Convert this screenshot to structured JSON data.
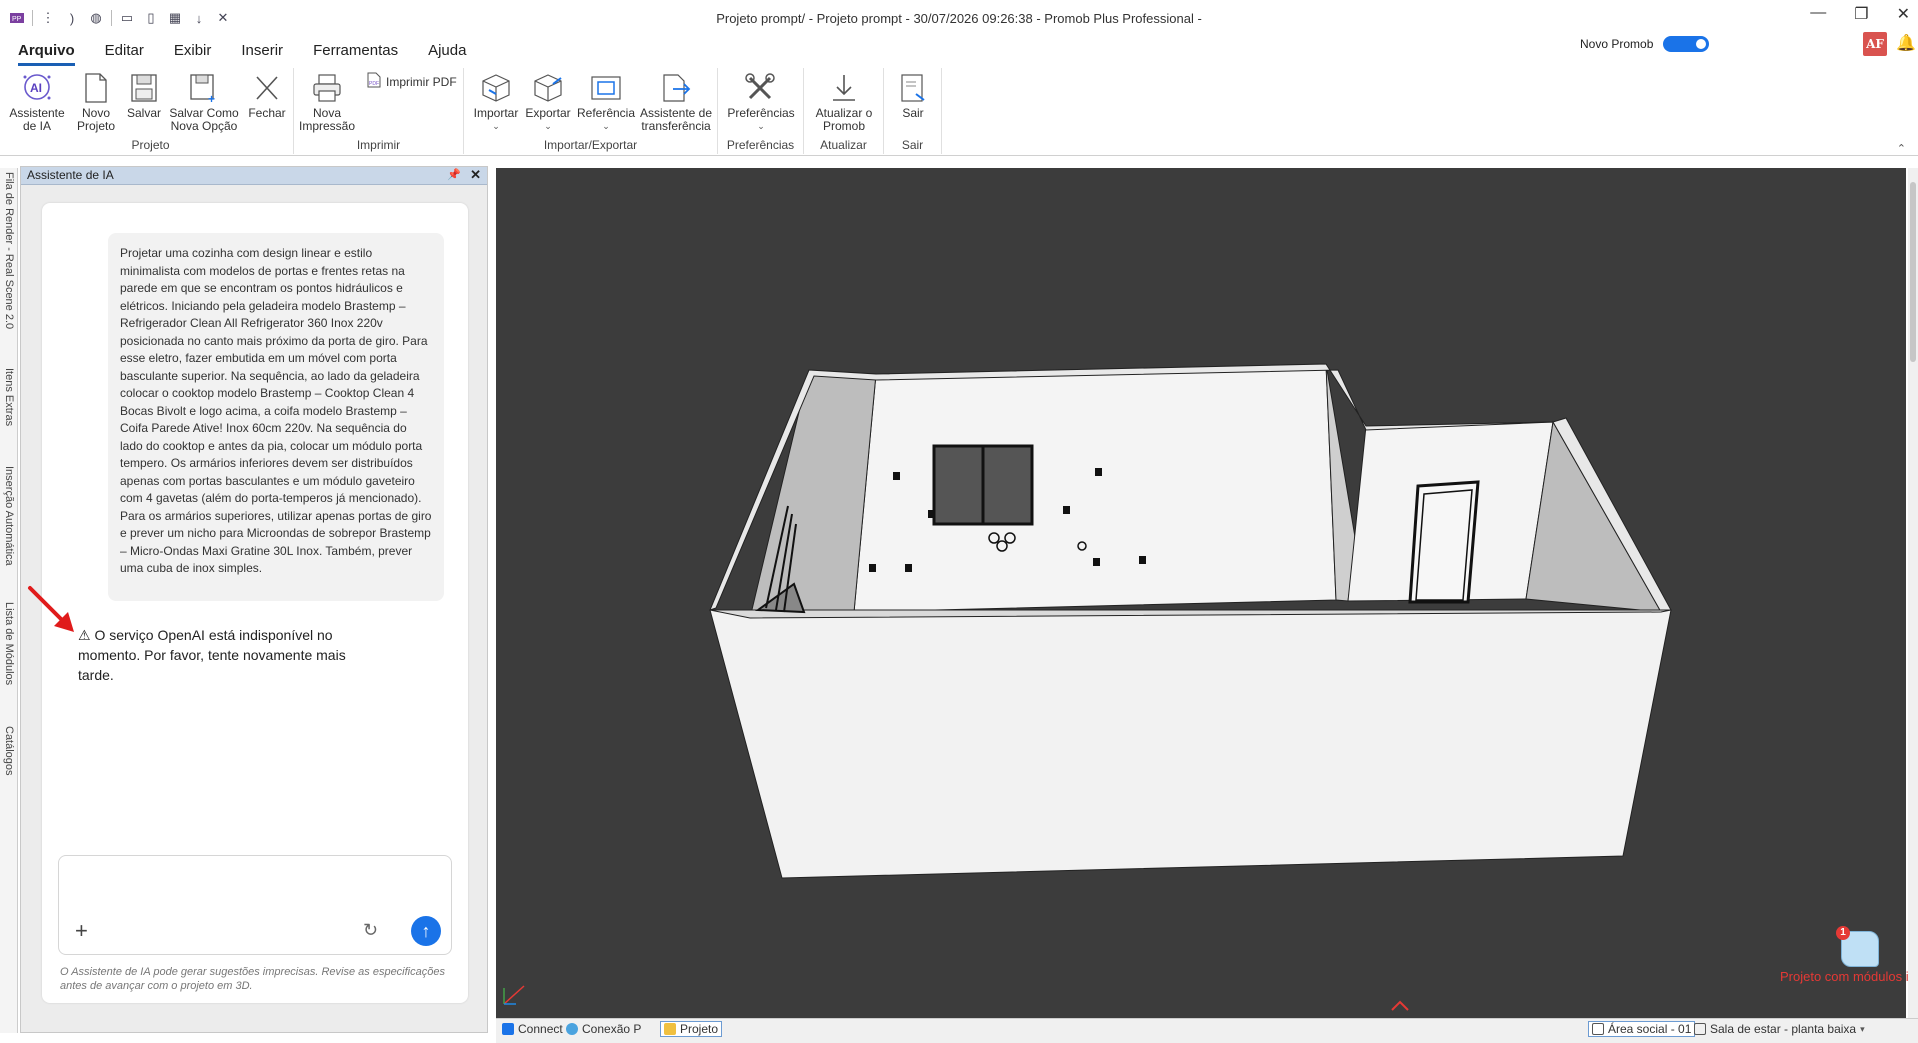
{
  "window": {
    "title": "Projeto prompt/ - Projeto prompt - 30/07/2026 09:26:38 - Promob Plus Professional -"
  },
  "menu": [
    "Arquivo",
    "Editar",
    "Exibir",
    "Inserir",
    "Ferramentas",
    "Ajuda"
  ],
  "header": {
    "novo_promob_label": "Novo Promob",
    "novo_promob_enabled": true,
    "user_initials": "AF"
  },
  "ribbon": {
    "projeto": {
      "label": "Projeto",
      "buttons": [
        "Assistente de IA",
        "Novo Projeto",
        "Salvar",
        "Salvar Como Nova Opção",
        "Fechar"
      ]
    },
    "imprimir": {
      "label": "Imprimir",
      "buttons": [
        "Nova Impressão",
        "Imprimir PDF"
      ]
    },
    "importar_exportar": {
      "label": "Importar/Exportar",
      "buttons": [
        "Importar",
        "Exportar",
        "Referência",
        "Assistente de transferência"
      ]
    },
    "preferencias": {
      "label": "Preferências",
      "buttons": [
        "Preferências"
      ]
    },
    "atualizar": {
      "label": "Atualizar",
      "buttons": [
        "Atualizar o Promob"
      ]
    },
    "sair": {
      "label": "Sair",
      "buttons": [
        "Sair"
      ]
    }
  },
  "side_tabs": [
    "Fila de Render - Real Scene 2.0",
    "Itens Extras",
    "Inserção Automática",
    "Lista de Módulos",
    "Catálogos"
  ],
  "ai_panel": {
    "title": "Assistente de IA",
    "user_message": "Projetar uma cozinha com design linear e estilo minimalista com modelos de portas e frentes retas na parede em que se encontram os pontos hidráulicos e elétricos. Iniciando pela geladeira modelo Brastemp – Refrigerador Clean All Refrigerator 360 Inox 220v posicionada no canto mais próximo da porta de giro. Para esse eletro, fazer embutida em um móvel com porta basculante superior. Na sequência, ao lado da geladeira colocar o cooktop modelo Brastemp – Cooktop Clean 4 Bocas Bivolt e logo acima, a coifa modelo Brastemp – Coifa Parede Ative! Inox 60cm 220v. Na sequência do lado do cooktop e antes da pia, colocar um módulo porta tempero. Os armários inferiores devem ser distribuídos apenas com portas basculantes e um módulo gaveteiro com 4 gavetas (além do porta-temperos já mencionado). Para os armários superiores, utilizar apenas portas de giro e prever um nicho para Microondas de sobrepor Brastemp – Micro-Ondas Maxi Gratine 30L Inox. Também, prever uma cuba de inox simples.",
    "warning_message": "O serviço OpenAI está indisponível no momento. Por favor, tente novamente mais tarde.",
    "input_value": "",
    "disclaimer": "O Assistente de IA pode gerar sugestões imprecisas. Revise as especificações antes de avançar com o projeto em 3D."
  },
  "viewport": {
    "warning_count": "1",
    "warning_text": "Projeto com módulos inválidos"
  },
  "bottom_bar": {
    "tabs": [
      "Connect",
      "Conexão P",
      "Projeto"
    ],
    "selected_tab": "Projeto",
    "area": "Área social - 01",
    "room": "Sala de estar - planta baixa"
  },
  "colors": {
    "accent": "#1a73e8",
    "viewport_bg": "#3c3c3c",
    "warning": "#e53935"
  }
}
